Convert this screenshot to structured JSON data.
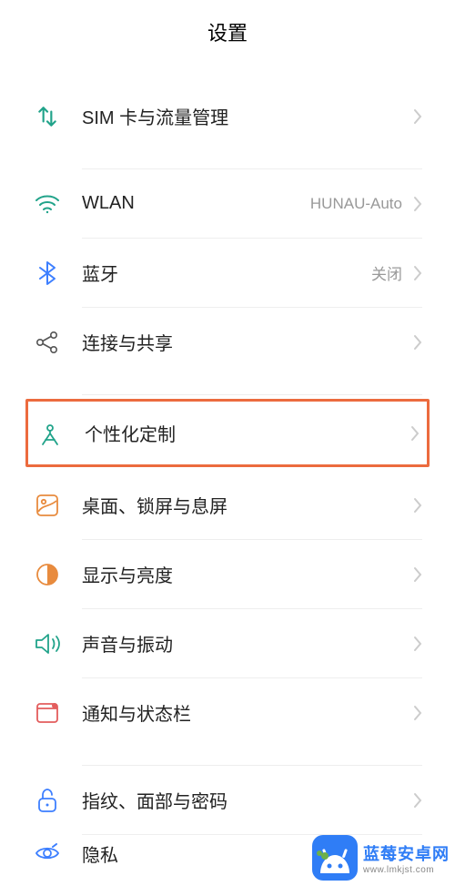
{
  "header": {
    "title": "设置"
  },
  "groups": [
    [
      {
        "id": "sim",
        "icon": "sim-swap-icon",
        "label": "SIM 卡与流量管理",
        "value": ""
      }
    ],
    [
      {
        "id": "wlan",
        "icon": "wifi-icon",
        "label": "WLAN",
        "value": "HUNAU-Auto"
      },
      {
        "id": "bluetooth",
        "icon": "bluetooth-icon",
        "label": "蓝牙",
        "value": "关闭"
      },
      {
        "id": "share",
        "icon": "share-icon",
        "label": "连接与共享",
        "value": ""
      }
    ],
    [
      {
        "id": "personalization",
        "icon": "compass-icon",
        "label": "个性化定制",
        "value": "",
        "highlighted": true
      },
      {
        "id": "desktop",
        "icon": "gallery-icon",
        "label": "桌面、锁屏与息屏",
        "value": ""
      },
      {
        "id": "display",
        "icon": "brightness-icon",
        "label": "显示与亮度",
        "value": ""
      },
      {
        "id": "sound",
        "icon": "sound-icon",
        "label": "声音与振动",
        "value": ""
      },
      {
        "id": "notification",
        "icon": "notification-icon",
        "label": "通知与状态栏",
        "value": ""
      }
    ],
    [
      {
        "id": "biometric",
        "icon": "lock-icon",
        "label": "指纹、面部与密码",
        "value": ""
      },
      {
        "id": "privacy",
        "icon": "privacy-icon",
        "label": "隐私",
        "value": ""
      }
    ]
  ],
  "colors": {
    "accent": "#21a38a",
    "highlight": "#ec6b3e",
    "iconBlue": "#3d7fff",
    "muted": "#999"
  },
  "watermark": {
    "cn": "蓝莓安卓网",
    "url": "www.lmkjst.com"
  }
}
